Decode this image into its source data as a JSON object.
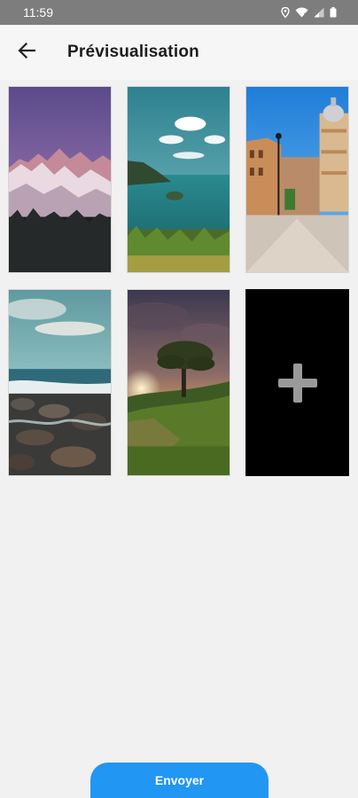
{
  "status_bar": {
    "time": "11:59",
    "icons": [
      "location-icon",
      "wifi-icon",
      "signal-icon",
      "battery-icon"
    ]
  },
  "app_bar": {
    "back_icon": "arrow-left-icon",
    "title": "Prévisualisation"
  },
  "gallery": {
    "images": [
      {
        "subject": "snowy mountain range at dusk with purple sky"
      },
      {
        "subject": "turquoise lake with islands and clouds"
      },
      {
        "subject": "city street with historic domed building and lamp post"
      },
      {
        "subject": "rocky seashore with waves at sunset"
      },
      {
        "subject": "lone tree on a hill at sunset"
      }
    ],
    "add_tile_icon": "plus-icon"
  },
  "actions": {
    "send_label": "Envoyer"
  },
  "colors": {
    "accent": "#2196f3",
    "status_bar": "#7d7d7d",
    "background": "#f1f1f1"
  }
}
